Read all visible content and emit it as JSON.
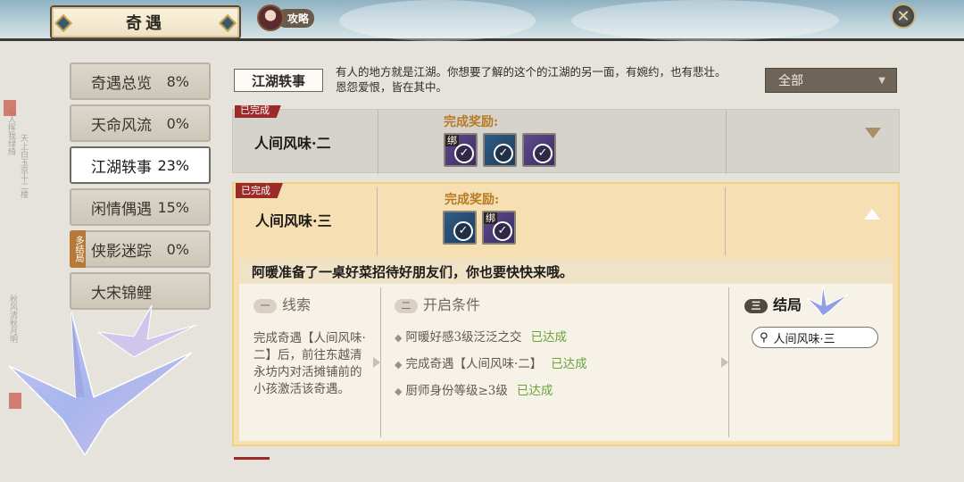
{
  "header": {
    "title": "奇遇",
    "guide_label": "攻略"
  },
  "sidebar": {
    "items": [
      {
        "label": "奇遇总览",
        "pct": "8%"
      },
      {
        "label": "天命风流",
        "pct": "0%"
      },
      {
        "label": "江湖轶事",
        "pct": "23%"
      },
      {
        "label": "闲情偶遇",
        "pct": "15%"
      },
      {
        "label": "侠影迷踪",
        "pct": "0%",
        "badge": "多结局"
      },
      {
        "label": "大宋锦鲤",
        "pct": ""
      }
    ],
    "active_index": 2
  },
  "section": {
    "label": "江湖轶事",
    "description": "有人的地方就是江湖。你想要了解的这个的江湖的另一面，有婉约，也有悲壮。恩怨爱恨，皆在其中。",
    "filter_value": "全部"
  },
  "entries": [
    {
      "status": "已完成",
      "title": "人间风味·二",
      "reward_label": "完成奖励:",
      "rewards": [
        {
          "color": "purple",
          "bind_tag": "绑"
        },
        {
          "color": "blue",
          "bind_tag": ""
        },
        {
          "color": "purple",
          "bind_tag": ""
        }
      ],
      "expanded": false
    },
    {
      "status": "已完成",
      "title": "人间风味·三",
      "reward_label": "完成奖励:",
      "rewards": [
        {
          "color": "blue",
          "bind_tag": ""
        },
        {
          "color": "purple",
          "bind_tag": "绑"
        }
      ],
      "expanded": true,
      "description": "阿暖准备了一桌好菜招待好朋友们，你也要快快来哦。",
      "clue": {
        "num": "一",
        "title": "线索",
        "text": "完成奇遇【人间风味·二】后，前往东越清永坊内对活摊铺前的小孩激活该奇遇。"
      },
      "conditions": {
        "num": "二",
        "title": "开启条件",
        "items": [
          {
            "text": "阿暖好感3级泛泛之交",
            "status": "已达成"
          },
          {
            "text": "完成奇遇【人间风味·二】",
            "status": "已达成"
          },
          {
            "text": "厨师身份等级≥3级",
            "status": "已达成"
          }
        ]
      },
      "ending": {
        "num": "三",
        "title": "结局",
        "search_value": "人间风味·三"
      }
    }
  ],
  "colors": {
    "accent_gold": "#b87a24",
    "done_red": "#9c2a2a",
    "achieved_green": "#6aa33c",
    "expanded_bg": "#f5dfb3"
  },
  "icons": [
    "close-icon",
    "search-icon",
    "check-icon",
    "chevron-down-icon",
    "chevron-up-icon",
    "paper-crane-icon"
  ]
}
